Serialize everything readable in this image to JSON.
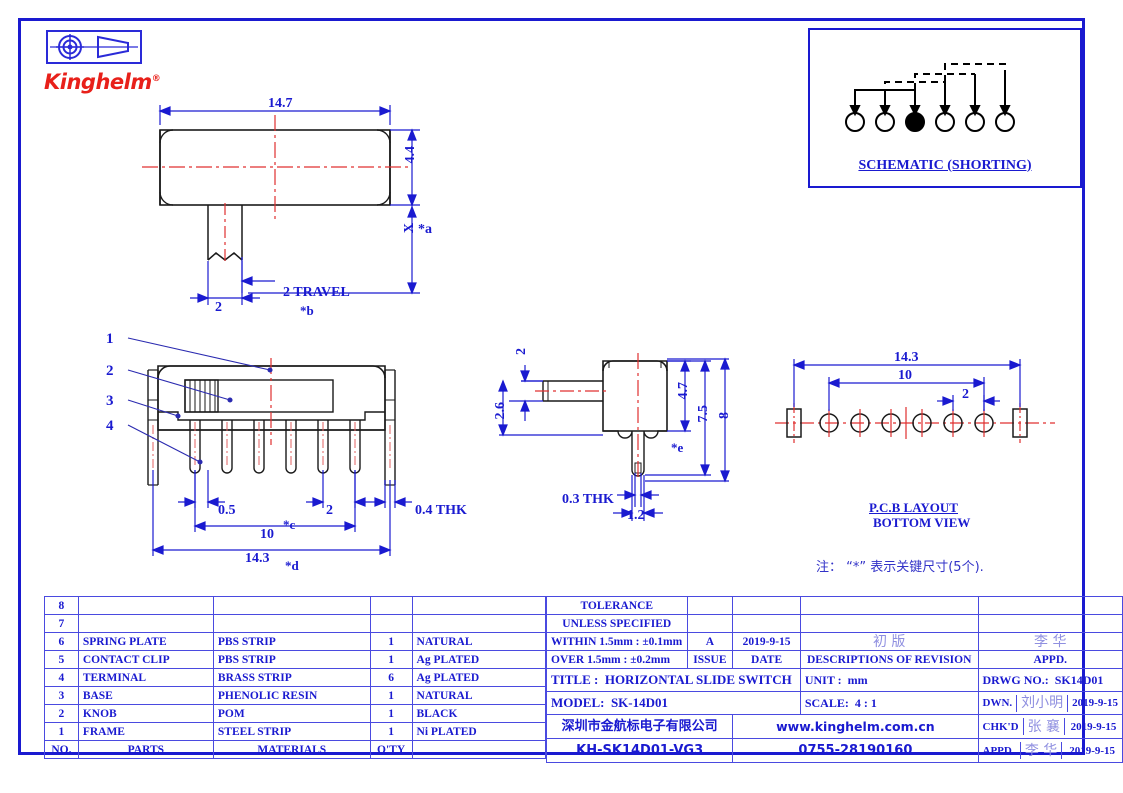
{
  "logo": {
    "brand": "Kinghelm",
    "trademark": "®",
    "projection_symbol": "first-angle-projection"
  },
  "schematic": {
    "caption": "SCHEMATIC  (SHORTING)",
    "pin_count": 6,
    "common_pin_index": 3
  },
  "top_view": {
    "dim_width": "14.7",
    "dim_height": "4.4",
    "dim_knob_height": "*a",
    "dim_knob_height_prefix": "X",
    "dim_travel": "2  TRAVEL",
    "dim_travel_note": "*b",
    "dim_knob_width": "2"
  },
  "front_view": {
    "callouts": [
      "1",
      "2",
      "3",
      "4"
    ],
    "dim_pin_offset": "0.5",
    "dim_pin_pitch": "2",
    "dim_thickness": "0.4  THK",
    "dim_pin_span": "10",
    "dim_pin_span_note": "*c",
    "dim_overall": "14.3",
    "dim_overall_note": "*d"
  },
  "side_view": {
    "dim_knob_thk": "2",
    "dim_knob_pos": "2.6",
    "dim_body_h": "4.7",
    "dim_body_h_note": "*e",
    "dim_total_h": "7.5",
    "dim_overall_h": "8",
    "dim_pin_thk": "0.3  THK",
    "dim_pin_w": "1.2"
  },
  "pcb_layout": {
    "dim_overall": "14.3",
    "dim_span": "10",
    "dim_pitch": "2",
    "caption_line1": "P.C.B  LAYOUT",
    "caption_line2": "BOTTOM  VIEW"
  },
  "note": "注： “*”  表示关键尺寸(5个).",
  "bom": {
    "headers": {
      "no": "NO.",
      "parts": "PARTS",
      "materials": "MATERIALS",
      "qty": "Q'TY",
      "finish": ""
    },
    "rows": [
      {
        "no": "8",
        "parts": "",
        "materials": "",
        "qty": "",
        "finish": ""
      },
      {
        "no": "7",
        "parts": "",
        "materials": "",
        "qty": "",
        "finish": ""
      },
      {
        "no": "6",
        "parts": "SPRING  PLATE",
        "materials": "PBS  STRIP",
        "qty": "1",
        "finish": "NATURAL"
      },
      {
        "no": "5",
        "parts": "CONTACT  CLIP",
        "materials": "PBS  STRIP",
        "qty": "1",
        "finish": "Ag  PLATED"
      },
      {
        "no": "4",
        "parts": "TERMINAL",
        "materials": "BRASS  STRIP",
        "qty": "6",
        "finish": "Ag  PLATED"
      },
      {
        "no": "3",
        "parts": "BASE",
        "materials": "PHENOLIC  RESIN",
        "qty": "1",
        "finish": "NATURAL"
      },
      {
        "no": "2",
        "parts": "KNOB",
        "materials": "POM",
        "qty": "1",
        "finish": "BLACK"
      },
      {
        "no": "1",
        "parts": "FRAME",
        "materials": "STEEL  STRIP",
        "qty": "1",
        "finish": "Ni  PLATED"
      }
    ]
  },
  "title_block": {
    "tolerance_title_1": "TOLERANCE",
    "tolerance_title_2": "UNLESS   SPECIFIED",
    "tolerance_within": "WITHIN 1.5mm : ±0.1mm",
    "tolerance_over": "OVER 1.5mm : ±0.2mm",
    "issue_value": "A",
    "issue_label": "ISSUE",
    "date_value": "2019-9-15",
    "date_label": "DATE",
    "revision_value": "初   版",
    "revision_label": "DESCRIPTIONS  OF  REVISION",
    "appd_value": "李 华",
    "appd_label": "APPD.",
    "title_label": "TITLE :",
    "title_value": "HORIZONTAL  SLIDE  SWITCH",
    "model_label": "MODEL:",
    "model_value": "SK-14D01",
    "unit_label": "UNIT :",
    "unit_value": "mm",
    "scale_label": "SCALE:",
    "scale_value": "4 : 1",
    "drwg_label": "DRWG NO.:",
    "drwg_value": "SK14D01",
    "dwn_label": "DWN.",
    "dwn_name": "刘小明",
    "dwn_date": "2019-9-15",
    "chkd_label": "CHK'D",
    "chkd_name": "张 襄",
    "chkd_date": "2019-9-15",
    "appd_row_label": "APPD.",
    "appd_name": "李 华",
    "appd_date": "2019-9-15",
    "company_cn": "深圳市金航标电子有限公司",
    "website": "www.kinghelm.com.cn",
    "part_number": "KH-SK14D01-VG3",
    "phone": "0755-28190160"
  },
  "colors": {
    "frame": "#1a1ad0",
    "dimension": "#1a1ad0",
    "centerline": "#e03030",
    "brand": "#e8201a",
    "outline": "#1a1a1a"
  }
}
